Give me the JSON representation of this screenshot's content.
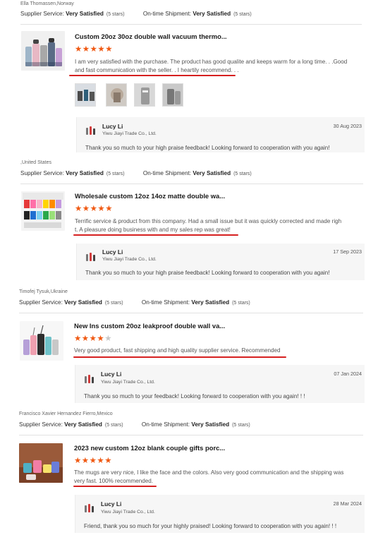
{
  "labels": {
    "supplier_service": "Supplier Service:",
    "ontime_shipment": "On-time Shipment:"
  },
  "reviews": [
    {
      "reviewer": "Ella Thomassen,Norway",
      "supplier_rating": "Very Satisfied",
      "supplier_stars": "(5 stars)",
      "shipment_rating": "Very Satisfied",
      "shipment_stars": "(5 stars)",
      "product_title": "Custom 20oz 30oz double wall vacuum thermo...",
      "stars": 5,
      "text_line1": "I am very satisfied with the purchase. The product has good qualite and keeps warm for a long time. . .Good",
      "text_line2": "and fast communication with the seller. . I heartily recommend. . .",
      "reply_name": "Lucy Li",
      "reply_company": "Yiwu Jiayi Trade Co., Ltd.",
      "reply_date": "30 Aug 2023",
      "reply_text": "Thank you so much to your high praise feedback!  Looking forward to cooperation with you again!"
    },
    {
      "reviewer": ",United States",
      "supplier_rating": "Very Satisfied",
      "supplier_stars": "(5 stars)",
      "shipment_rating": "Very Satisfied",
      "shipment_stars": "(5 stars)",
      "product_title": "Wholesale custom 12oz 14oz matte double wa...",
      "stars": 5,
      "text_line1": "Terrific service & product from this company.  Had a small issue but it was quickly corrected and made righ",
      "text_line2": "t.  A pleasure doing business with and my sales rep was great!",
      "reply_name": "Lucy Li",
      "reply_company": "Yiwu Jiayi Trade Co., Ltd.",
      "reply_date": "17 Sep 2023",
      "reply_text": "Thank you so much to your high praise feedback!  Looking forward to cooperation with you again!"
    },
    {
      "reviewer": "Timofej Tysuk,Ukraine",
      "supplier_rating": "Very Satisfied",
      "supplier_stars": "(5 stars)",
      "shipment_rating": "Very Satisfied",
      "shipment_stars": "(5 stars)",
      "product_title": "New Ins custom 20oz leakproof double wall va...",
      "stars": 4,
      "text_line1": "Very good product, fast shipping and high quality supplier service. Recommended",
      "text_line2": "",
      "reply_name": "Lucy Li",
      "reply_company": "Yiwu Jiayi Trade Co., Ltd.",
      "reply_date": "07 Jan 2024",
      "reply_text": "Thank you so much to your feedback!  Looking forward to cooperation with you again!  !  !"
    },
    {
      "reviewer": "Francisco Xavier Hernandez Fierro,Mexico",
      "supplier_rating": "Very Satisfied",
      "supplier_stars": "(5 stars)",
      "shipment_rating": "Very Satisfied",
      "shipment_stars": "(5 stars)",
      "product_title": "2023 new custom 12oz blank couple gifts porc...",
      "stars": 5,
      "text_line1": "The mugs are very nice, I like the face and the colors. Also very good communication and the shipping was",
      "text_line2": "very fast. 100% recommended.",
      "reply_name": "Lucy Li",
      "reply_company": "Yiwu Jiayi Trade Co., Ltd.",
      "reply_date": "28 Mar 2024",
      "reply_text": "Friend,  thank you so much for your highly praised!  Looking forward to cooperation with you again!  !  !"
    }
  ],
  "colors": {
    "star": "#f05a14",
    "underline": "#d62020",
    "reply_bg": "#f6f6f6"
  }
}
